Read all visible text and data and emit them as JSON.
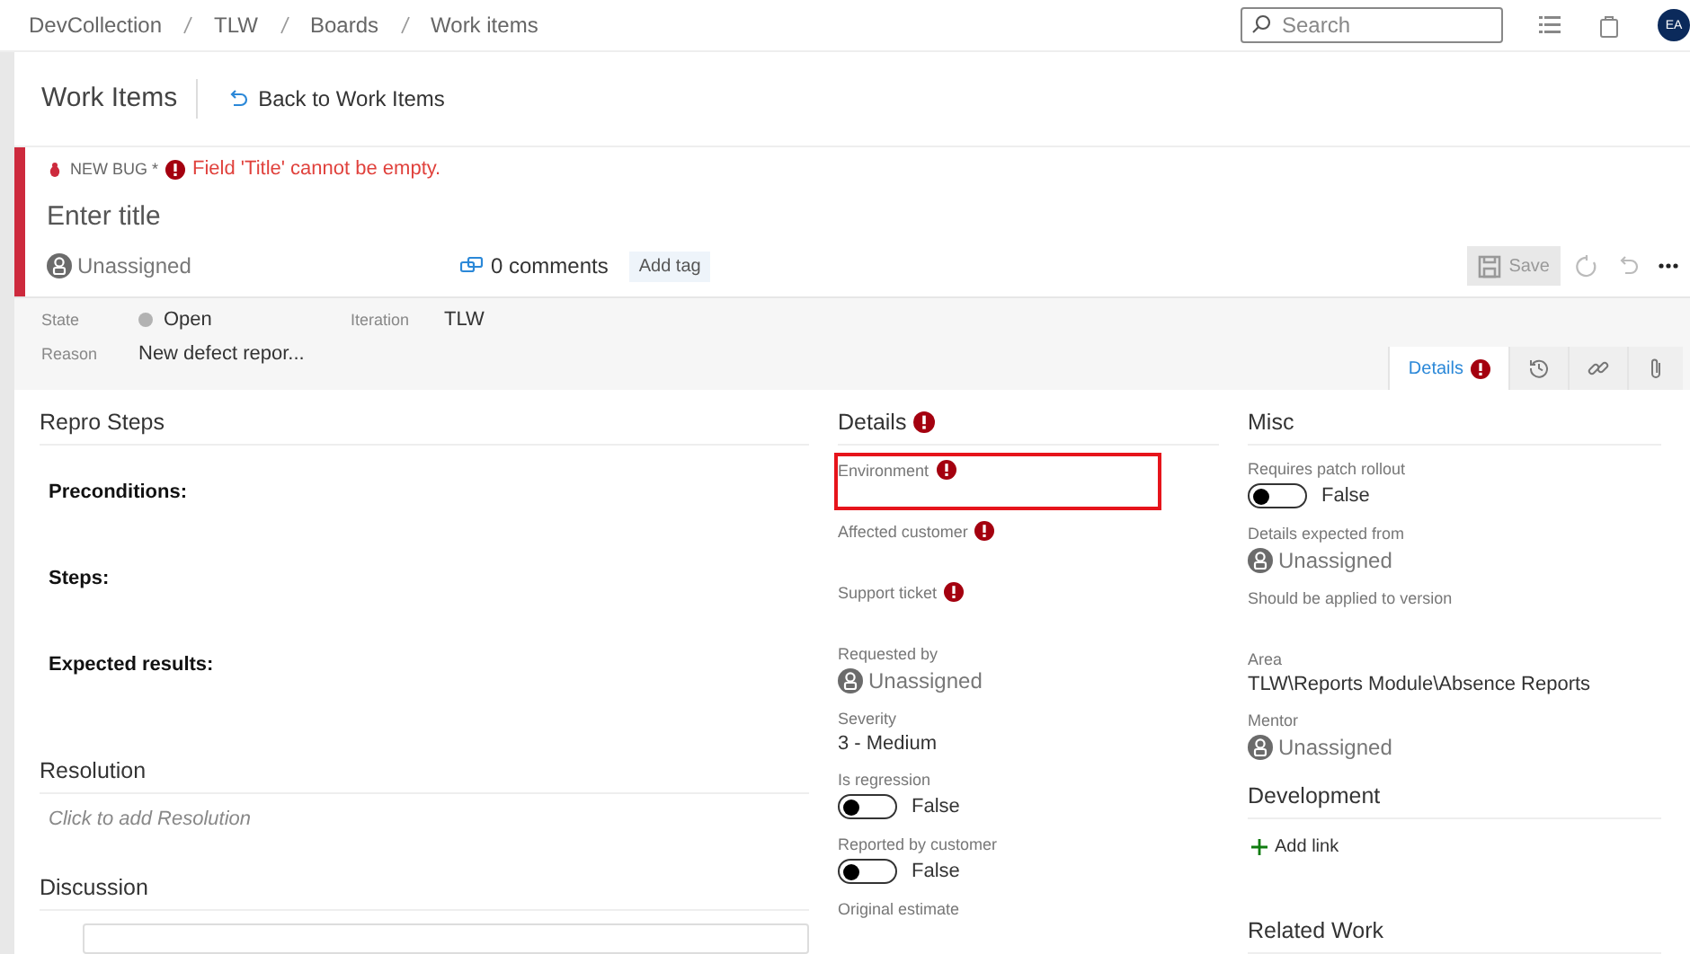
{
  "breadcrumb": [
    "DevCollection",
    "TLW",
    "Boards",
    "Work items"
  ],
  "search": {
    "placeholder": "Search"
  },
  "user": {
    "initials": "EA"
  },
  "header": {
    "title": "Work Items",
    "back": "Back to Work Items"
  },
  "work_item": {
    "type": "NEW BUG *",
    "error": "Field 'Title' cannot be empty.",
    "title_placeholder": "Enter title",
    "assignee": "Unassigned",
    "comments": "0 comments",
    "add_tag": "Add tag",
    "save": {
      "label": "Save",
      "disabled": true
    }
  },
  "state_fields": [
    {
      "label": "State",
      "value": "Open",
      "kind": "state"
    },
    {
      "label": "Iteration",
      "value": "TLW",
      "kind": "text"
    },
    {
      "label": "Reason",
      "value": "New defect repor...",
      "kind": "text"
    }
  ],
  "tabs": [
    {
      "kind": "text",
      "label": "Details",
      "selected": true,
      "error": true
    },
    {
      "kind": "history",
      "selected": false
    },
    {
      "kind": "links",
      "selected": false
    },
    {
      "kind": "attachments",
      "selected": false
    }
  ],
  "repro_steps": {
    "heading": "Repro Steps",
    "lines": [
      "Preconditions:",
      "Steps:",
      "Expected results:"
    ]
  },
  "resolution": {
    "heading": "Resolution",
    "placeholder": "Click to add Resolution"
  },
  "discussion": {
    "heading": "Discussion"
  },
  "details": {
    "heading": "Details",
    "error": true,
    "fields": [
      {
        "label": "Environment",
        "kind": "empty",
        "required": true,
        "highlighted": true
      },
      {
        "label": "Affected customer",
        "kind": "empty",
        "required": true,
        "highlighted": false
      },
      {
        "label": "Support ticket",
        "kind": "empty",
        "required": true,
        "highlighted": false
      },
      {
        "label": "Requested by",
        "kind": "identity",
        "value": "Unassigned",
        "required": false,
        "highlighted": false
      },
      {
        "label": "Severity",
        "kind": "text",
        "value": "3 - Medium",
        "required": false,
        "highlighted": false
      },
      {
        "label": "Is regression",
        "kind": "toggle",
        "value": "False",
        "on": false,
        "required": false,
        "highlighted": false
      },
      {
        "label": "Reported by customer",
        "kind": "toggle",
        "value": "False",
        "on": false,
        "required": false,
        "highlighted": false
      },
      {
        "label": "Original estimate",
        "kind": "empty",
        "required": false,
        "highlighted": false
      }
    ]
  },
  "misc": {
    "heading": "Misc",
    "fields": [
      {
        "label": "Requires patch rollout",
        "kind": "toggle",
        "value": "False",
        "on": false
      },
      {
        "label": "Details expected from",
        "kind": "identity",
        "value": "Unassigned"
      },
      {
        "label": "Should be applied to version",
        "kind": "empty"
      },
      {
        "label": "Area",
        "kind": "text",
        "value": "TLW\\Reports Module\\Absence Reports"
      },
      {
        "label": "Mentor",
        "kind": "identity",
        "value": "Unassigned"
      }
    ]
  },
  "development": {
    "heading": "Development",
    "add_link": "Add link"
  },
  "related_work": {
    "heading": "Related Work"
  }
}
